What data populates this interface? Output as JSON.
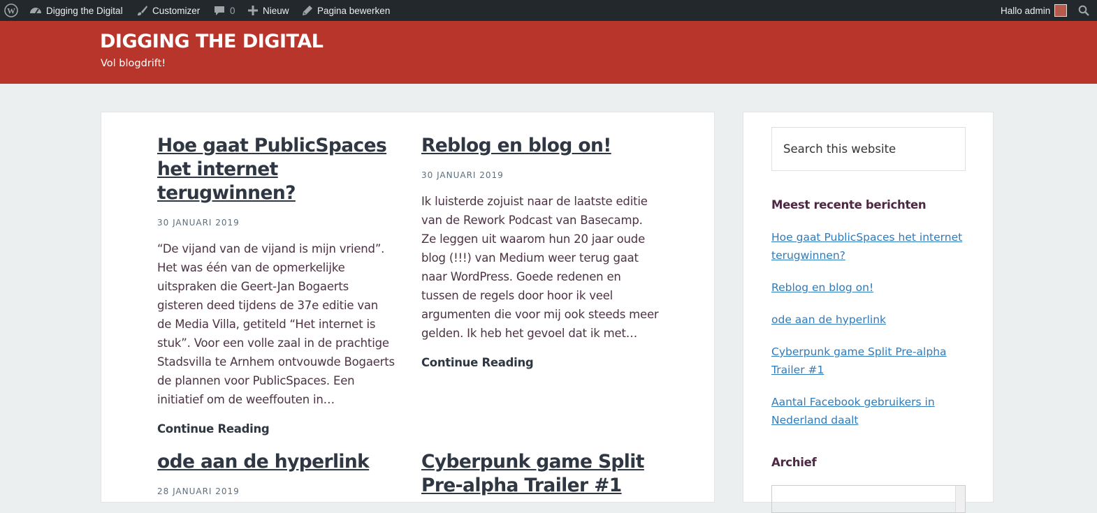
{
  "adminbar": {
    "site_name": "Digging the Digital",
    "customizer": "Customizer",
    "comments_count": "0",
    "new": "Nieuw",
    "edit_page": "Pagina bewerken",
    "greeting": "Hallo admin"
  },
  "site": {
    "title": "DIGGING THE DIGITAL",
    "description": "Vol blogdrift!"
  },
  "posts": [
    {
      "title": "Hoe gaat PublicSpaces het internet terugwinnen?",
      "date": "30 JANUARI 2019",
      "excerpt": "“De vijand van de vijand is mijn vriend”. Het was één van de opmerkelijke uitspraken die Geert-Jan Bogaerts gisteren deed tijdens de 37e editie van de Media Villa, getiteld “Het internet is stuk”. Voor een volle zaal in de prachtige Stadsvilla te Arnhem ontvouwde Bogaerts de plannen voor PublicSpaces. Een initiatief om de weeffouten in…",
      "more": "Continue Reading"
    },
    {
      "title": "Reblog en blog on!",
      "date": "30 JANUARI 2019",
      "excerpt": "Ik luisterde zojuist naar de laatste editie van de Rework Podcast van Basecamp. Ze leggen uit waarom hun 20 jaar oude blog (!!!) van Medium weer terug gaat naar WordPress. Goede redenen en tussen de regels door hoor ik veel argumenten die voor mij ook steeds meer gelden. Ik heb het gevoel dat ik met…",
      "more": "Continue Reading"
    },
    {
      "title": "ode aan de hyperlink",
      "date": "28 JANUARI 2019"
    },
    {
      "title": "Cyberpunk game Split Pre-alpha Trailer #1"
    }
  ],
  "sidebar": {
    "search_placeholder": "Search this website",
    "recent_title": "Meest recente berichten",
    "recent": [
      "Hoe gaat PublicSpaces het internet terugwinnen?",
      "Reblog en blog on!",
      "ode aan de hyperlink",
      "Cyberpunk game Split Pre-alpha Trailer #1",
      "Aantal Facebook gebruikers in Nederland daalt"
    ],
    "archive_title": "Archief"
  }
}
